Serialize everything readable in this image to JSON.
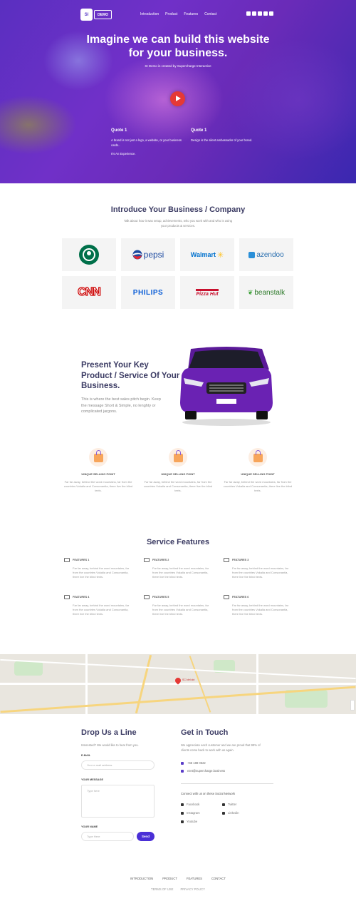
{
  "brand": {
    "logo_mark": "SI",
    "logo_word": "DEMO"
  },
  "nav": [
    "Introduction",
    "Product",
    "Features",
    "Contact"
  ],
  "hero": {
    "title": "Imagine we can build this website for your business.",
    "subtitle": "SI Demo is created by Supercharge Interactive"
  },
  "quotes": [
    {
      "title": "Quote 1",
      "lines": [
        "A brand is not just a logo, a website, or your business cards..",
        "It's An Experience."
      ]
    },
    {
      "title": "Quote 1",
      "lines": [
        "Design is the silent ambassador of your brand."
      ]
    }
  ],
  "intro": {
    "title": "Introduce Your Business / Company",
    "desc": "Talk about how it was setup, achievements, who you work with and who is using your products & services."
  },
  "brands": [
    "STARBUCKS",
    "pepsi",
    "Walmart",
    "azendoo",
    "CNN",
    "PHILIPS",
    "Pizza Hut",
    "beanstalk"
  ],
  "present": {
    "title": "Present Your Key Product / Service Of Your Business.",
    "desc": "This is where the best sales pitch begin. Keep the message Short & Simple, no lenghty or complicated jargons."
  },
  "usps": [
    {
      "title": "UNIQUE SELLING POINT",
      "text": "Far far away, behind the word mountains, far from the countries Vokalia and Consonantia, there live the blind texts."
    },
    {
      "title": "UNIQUE SELLING POINT",
      "text": "Far far away, behind the word mountains, far from the countries Vokalia and Consonantia, there live the blind texts."
    },
    {
      "title": "UNIQUE SELLING POINT",
      "text": "Far far away, behind the word mountains, far from the countries Vokalia and Consonantia, there live the blind texts."
    }
  ],
  "features_title": "Service Features",
  "features": [
    {
      "title": "FEATURES 1",
      "text": "Far far away, behind the word mountains, far from the countries Vokalia and Consonantia, there live the blind texts."
    },
    {
      "title": "FEATURES 2",
      "text": "Far far away, behind the word mountains, far from the countries Vokalia and Consonantia, there live the blind texts."
    },
    {
      "title": "FEATURES 3",
      "text": "Far far away, behind the word mountains, far from the countries Vokalia and Consonantia, there live the blind texts."
    },
    {
      "title": "FEATURES 4",
      "text": "Far far away, behind the word mountains, far from the countries Vokalia and Consonantia, there live the blind texts."
    },
    {
      "title": "FEATURES 5",
      "text": "Far far away, behind the word mountains, far from the countries Vokalia and Consonantia, there live the blind texts."
    },
    {
      "title": "FEATURES 6",
      "text": "Far far away, behind the word mountains, far from the countries Vokalia and Consonantia, there live the blind texts."
    }
  ],
  "map": {
    "pin_label": "SCI del dot"
  },
  "form": {
    "title": "Drop Us a Line",
    "intro": "Interested? We would like to hear from you.",
    "email_label": "E-MAIL",
    "email_placeholder": "Your e-mail address",
    "message_label": "YOUR MESSAGE",
    "message_placeholder": "Type here",
    "name_label": "YOUR NAME",
    "name_placeholder": "Type Here",
    "send": "Send"
  },
  "contact": {
    "title": "Get in Touch",
    "desc": "We appreciate each customer and we are proud that 99% of clients come back to work with us again.",
    "phone": "+65 188 0522",
    "email": "ezet@supercharge.business",
    "social_title": "Connect with us on these Social Network",
    "socials": [
      "Facebook",
      "Twitter",
      "Instagram",
      "Linkedin",
      "Youtube"
    ]
  },
  "footer": {
    "nav": [
      "INTRODUCTION",
      "PRODUCT",
      "FEATURES",
      "CONTACT"
    ],
    "sub": [
      "TERMS OF USE",
      "PRIVACY POLICY"
    ]
  }
}
